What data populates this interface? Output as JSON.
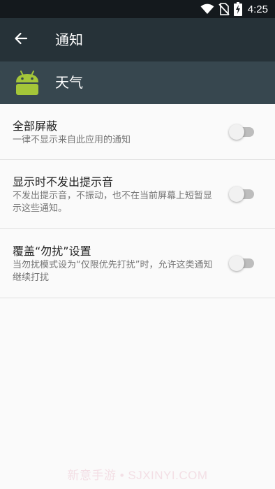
{
  "status_bar": {
    "time": "4:25",
    "icons": [
      "wifi-icon",
      "no-sim-icon",
      "battery-charging-icon"
    ]
  },
  "app_bar": {
    "back_icon": "arrow-left-icon",
    "title": "通知"
  },
  "app_header": {
    "app_icon": "android-icon",
    "app_name": "天气",
    "colors": {
      "icon": "#a4c639",
      "background": "#37474f"
    }
  },
  "settings": [
    {
      "title": "全部屏蔽",
      "summary": "一律不显示来自此应用的通知",
      "enabled": false
    },
    {
      "title": "显示时不发出提示音",
      "summary": "不发出提示音，不振动，也不在当前屏幕上短暂显示这些通知。",
      "enabled": false
    },
    {
      "title": "覆盖“勿扰”设置",
      "summary": "当勿扰模式设为“仅限优先打扰”时，允许这类通知继续打扰",
      "enabled": false
    }
  ],
  "watermark": "新意手游 • SJXINYI.COM",
  "colors": {
    "status_bar": "#14191d",
    "app_bar": "#263238",
    "background": "#fafafa"
  }
}
